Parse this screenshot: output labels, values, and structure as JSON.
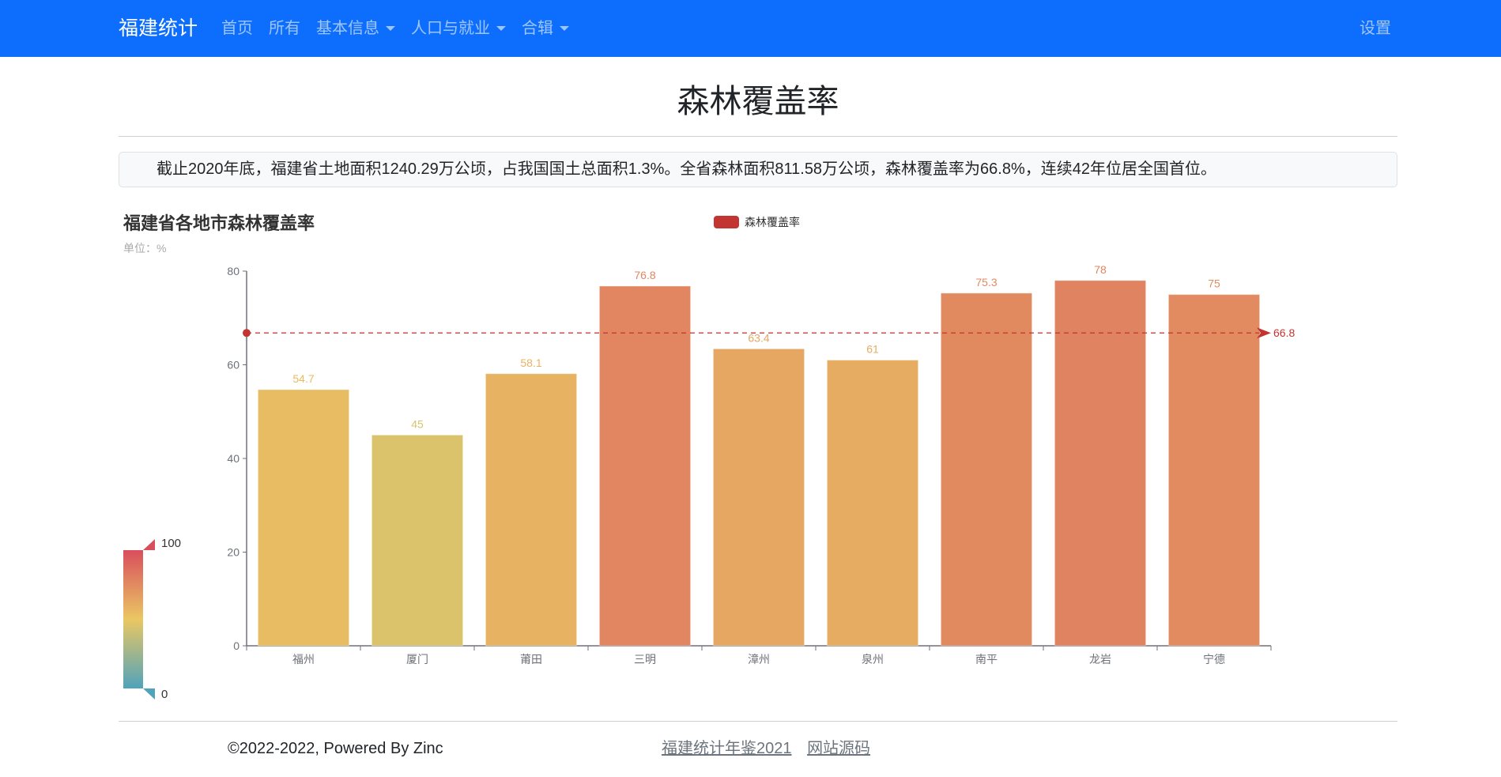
{
  "navbar": {
    "brand": "福建统计",
    "items": [
      {
        "label": "首页",
        "dropdown": false
      },
      {
        "label": "所有",
        "dropdown": false
      },
      {
        "label": "基本信息",
        "dropdown": true
      },
      {
        "label": "人口与就业",
        "dropdown": true
      },
      {
        "label": "合辑",
        "dropdown": true
      }
    ],
    "settings": "设置",
    "color": "#0d6efd"
  },
  "page": {
    "title": "森林覆盖率",
    "info": "截止2020年底，福建省土地面积1240.29万公顷，占我国国土总面积1.3%。全省森林面积811.58万公顷，森林覆盖率为66.8%，连续42年位居全国首位。"
  },
  "chart_data": {
    "type": "bar",
    "title": "福建省各地市森林覆盖率",
    "subtitle": "单位：%",
    "legend": [
      "森林覆盖率"
    ],
    "legend_position": "top-center",
    "categories": [
      "福州",
      "厦门",
      "莆田",
      "三明",
      "漳州",
      "泉州",
      "南平",
      "龙岩",
      "宁德"
    ],
    "series": [
      {
        "name": "森林覆盖率",
        "values": [
          54.7,
          45,
          58.1,
          76.8,
          63.4,
          61,
          75.3,
          78,
          75
        ]
      }
    ],
    "ylim": [
      0,
      80
    ],
    "yticks": [
      0,
      20,
      40,
      60,
      80
    ],
    "grid": false,
    "mark_line": {
      "type": "average",
      "value": 66.8,
      "label": "66.8",
      "color": "#c23531"
    },
    "visual_map": {
      "min": 0,
      "max": 100,
      "min_label": "0",
      "max_label": "100",
      "colors": [
        "#50a3ba",
        "#eac763",
        "#d94e5d"
      ],
      "position": "bottom-left"
    },
    "legend_color": "#c23531"
  },
  "footer": {
    "copyright": "©2022-2022, Powered By Zinc",
    "links": [
      "福建统计年鉴2021",
      "网站源码"
    ]
  }
}
